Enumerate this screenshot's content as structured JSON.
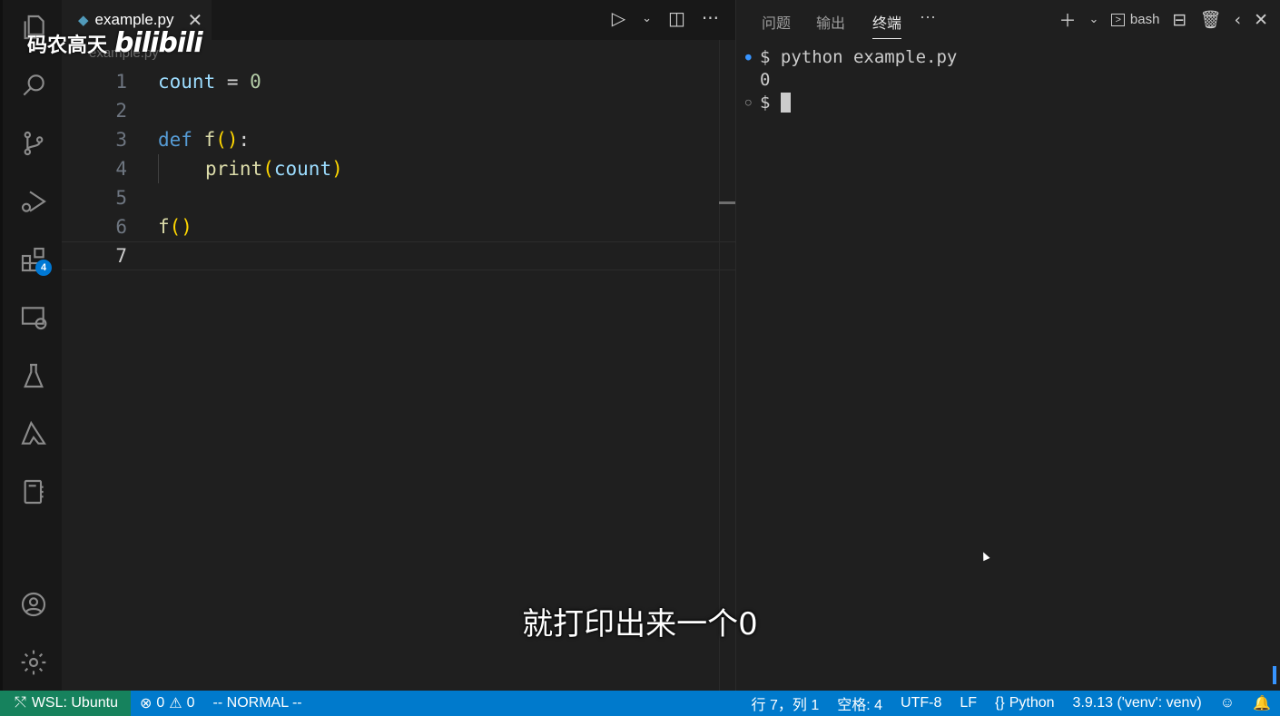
{
  "editor": {
    "tab_label": "example.py",
    "breadcrumb": "example.py",
    "lines": [
      {
        "n": "1"
      },
      {
        "n": "2"
      },
      {
        "n": "3"
      },
      {
        "n": "4"
      },
      {
        "n": "5"
      },
      {
        "n": "6"
      },
      {
        "n": "7"
      }
    ],
    "code": {
      "l1_var": "count",
      "l1_op": " = ",
      "l1_num": "0",
      "l3_kw": "def ",
      "l3_fn": "f",
      "l3_par": "()",
      "l3_colon": ":",
      "l4_fn": "print",
      "l4_par_open": "(",
      "l4_var": "count",
      "l4_par_close": ")",
      "l6_fn": "f",
      "l6_par": "()"
    }
  },
  "panel": {
    "tabs": [
      "问题",
      "输出",
      "终端"
    ],
    "more": "···",
    "shell_label": "bash",
    "terminal": {
      "prompt": "$ ",
      "command": "python example.py",
      "output": "0"
    }
  },
  "activity": {
    "extensions_badge": "4"
  },
  "status": {
    "remote": "WSL: Ubuntu",
    "errors": "0",
    "warnings": "0",
    "mode": "-- NORMAL --",
    "position": "行 7，列 1",
    "spaces": "空格: 4",
    "encoding": "UTF-8",
    "eol": "LF",
    "language": "Python",
    "interpreter": "3.9.13 ('venv': venv)"
  },
  "overlay": {
    "watermark_text": "码农高天",
    "watermark_logo": "bilibili",
    "subtitle": "就打印出来一个0"
  },
  "colors": {
    "status_bar": "#007acc",
    "remote_indicator": "#16825d",
    "keyword": "#569cd6",
    "function": "#dcdcaa",
    "variable": "#9cdcfe",
    "number": "#b5cea8",
    "bracket": "#ffd700"
  }
}
